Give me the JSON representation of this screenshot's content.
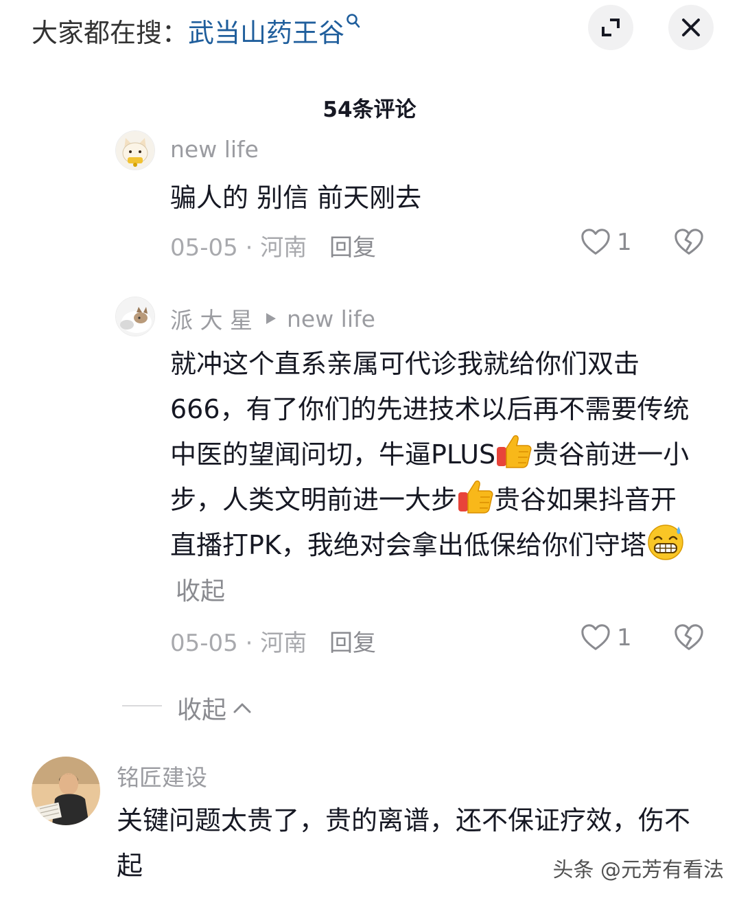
{
  "search": {
    "prefix": "大家都在搜：",
    "term": "武当山药王谷",
    "search_icon": "search-icon"
  },
  "toolbar": {
    "expand_icon": "expand-icon",
    "close_icon": "close-icon"
  },
  "comments_header": {
    "count_label": "54条评论"
  },
  "comments": [
    {
      "user": "new life",
      "text": "骗人的 别信 前天刚去",
      "date": "05-05",
      "location": "河南",
      "reply": "回复",
      "likes": "1"
    },
    {
      "user": "派 大 星",
      "reply_to": "new life",
      "text_parts": [
        "就冲这个直系亲属可代诊我就给你们双击666，有了你们的先进技术以后再不需要传统中医的望闻问切，牛逼PLUS",
        "贵谷前进一小步，人类文明前进一大步",
        "贵谷如果抖音开直播打PK，我绝对会拿出低保给你们守塔"
      ],
      "collapse": "收起",
      "date": "05-05",
      "location": "河南",
      "reply": "回复",
      "likes": "1"
    },
    {
      "user": "铭匠建设",
      "text": "关键问题太贵了，贵的离谱，还不保证疗效，伤不起"
    }
  ],
  "replies_toggle": {
    "label": "收起"
  },
  "watermark": {
    "text": "头条 @元芳有看法"
  },
  "colors": {
    "accent_link": "#1f5e9c",
    "text_primary": "#161823",
    "text_secondary": "#8a8b90"
  }
}
